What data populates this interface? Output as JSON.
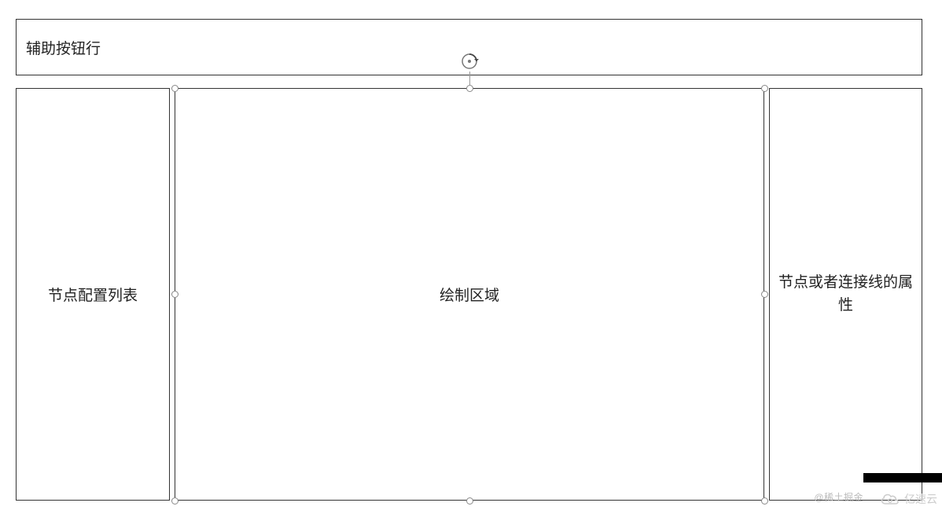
{
  "toolbar": {
    "label": "辅助按钮行"
  },
  "left_panel": {
    "label": "节点配置列表"
  },
  "center_panel": {
    "label": "绘制区域",
    "selected": true
  },
  "right_panel": {
    "label": "节点或者连接线的属性"
  },
  "watermark": {
    "left_text": "@稀土掘金",
    "right_text": "亿速云"
  }
}
